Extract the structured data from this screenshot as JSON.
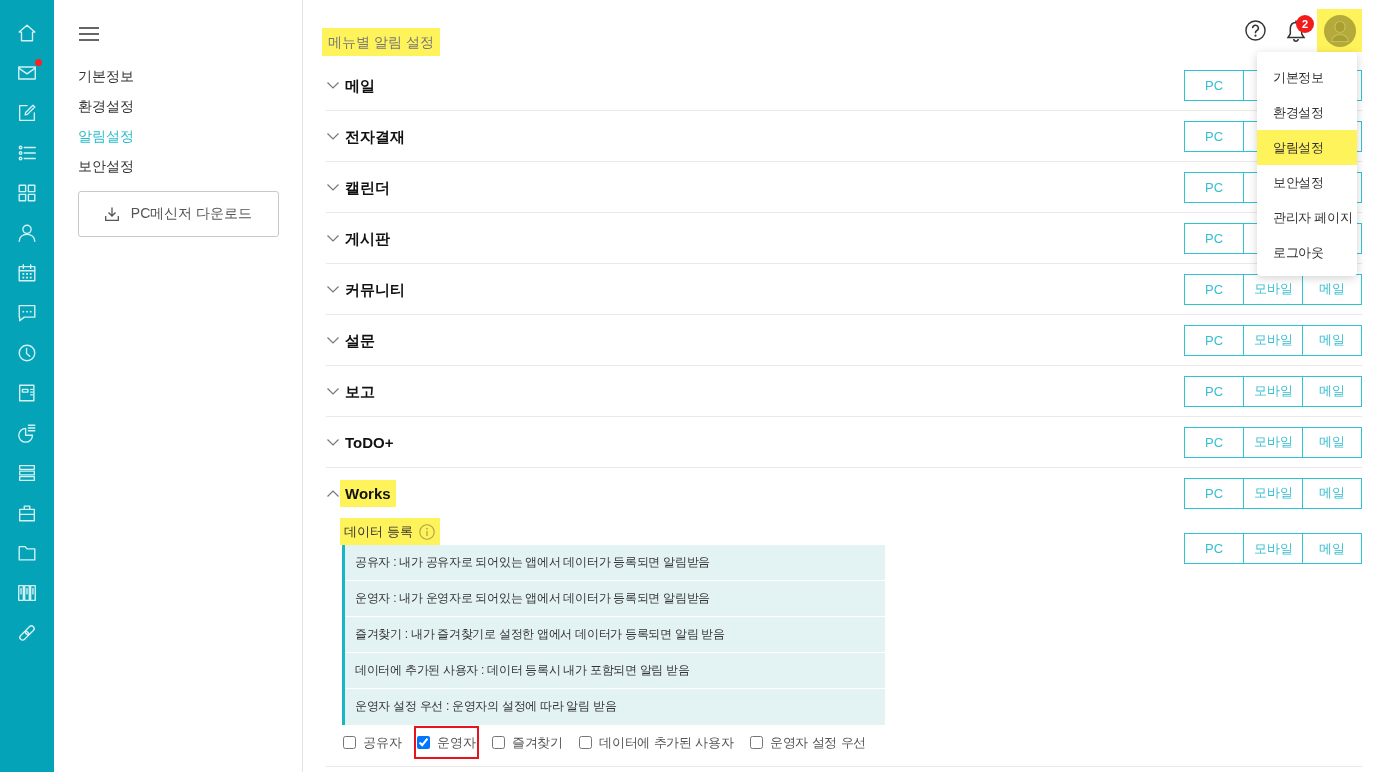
{
  "icon_rail": [
    {
      "notify": false
    },
    {
      "notify": true
    },
    {
      "notify": false
    },
    {
      "notify": false
    },
    {
      "notify": false
    },
    {
      "notify": false
    },
    {
      "notify": false
    },
    {
      "notify": false
    },
    {
      "notify": false
    },
    {
      "notify": false
    },
    {
      "notify": false
    },
    {
      "notify": false
    },
    {
      "notify": false
    },
    {
      "notify": false
    },
    {
      "notify": false
    },
    {
      "notify": false
    }
  ],
  "settings_menu": {
    "items": [
      {
        "label": "기본정보",
        "selected": false
      },
      {
        "label": "환경설정",
        "selected": false
      },
      {
        "label": "알림설정",
        "selected": true
      },
      {
        "label": "보안설정",
        "selected": false
      }
    ],
    "download_button": "PC메신저 다운로드"
  },
  "header": {
    "title": {
      "text": "메뉴별 알림 설정",
      "highlighted": true
    },
    "notification_count": "2",
    "avatar": {
      "highlighted": true
    }
  },
  "user_menu": {
    "items": [
      {
        "label": "기본정보",
        "highlighted": false
      },
      {
        "label": "환경설정",
        "highlighted": false
      },
      {
        "label": "알림설정",
        "highlighted": true
      },
      {
        "label": "보안설정",
        "highlighted": false
      },
      {
        "label": "관리자 페이지",
        "highlighted": false
      },
      {
        "label": "로그아웃",
        "highlighted": false
      }
    ]
  },
  "sections": [
    {
      "title": "메일",
      "expanded": false,
      "highlighted": false,
      "channels": [
        "PC"
      ]
    },
    {
      "title": "전자결재",
      "expanded": false,
      "highlighted": false,
      "channels": [
        "PC"
      ]
    },
    {
      "title": "캘린더",
      "expanded": false,
      "highlighted": false,
      "channels": [
        "PC"
      ]
    },
    {
      "title": "게시판",
      "expanded": false,
      "highlighted": false,
      "channels": [
        "PC"
      ]
    },
    {
      "title": "커뮤니티",
      "expanded": false,
      "highlighted": false,
      "channels": [
        "PC",
        "모바일",
        "메일"
      ]
    },
    {
      "title": "설문",
      "expanded": false,
      "highlighted": false,
      "channels": [
        "PC",
        "모바일",
        "메일"
      ]
    },
    {
      "title": "보고",
      "expanded": false,
      "highlighted": false,
      "channels": [
        "PC",
        "모바일",
        "메일"
      ]
    },
    {
      "title": "ToDO+",
      "expanded": false,
      "highlighted": false,
      "channels": [
        "PC",
        "모바일",
        "메일"
      ]
    },
    {
      "title": "Works",
      "expanded": true,
      "highlighted": true,
      "channels": [
        "PC",
        "모바일",
        "메일"
      ],
      "subsections": [
        {
          "title": "데이터 등록",
          "highlighted": true,
          "channels": [
            "PC",
            "모바일",
            "메일"
          ],
          "descriptions": [
            "공유자 : 내가 공유자로 되어있는 앱에서 데이터가 등록되면 알림받음",
            "운영자 : 내가 운영자로 되어있는 앱에서 데이터가 등록되면 알림받음",
            "즐겨찾기 : 내가 즐겨찾기로 설정한 앱에서 데이터가 등록되면 알림 받음",
            "데이터에 추가된 사용자 : 데이터 등록시 내가 포함되면 알림 받음",
            "운영자 설정 우선 : 운영자의 설정에 따라 알림 받음"
          ],
          "options": [
            {
              "label": "공유자",
              "checked": false,
              "outlined": false
            },
            {
              "label": "운영자",
              "checked": true,
              "outlined": true
            },
            {
              "label": "즐겨찾기",
              "checked": false,
              "outlined": false
            },
            {
              "label": "데이터에 추가된 사용자",
              "checked": false,
              "outlined": false
            },
            {
              "label": "운영자 설정 우선",
              "checked": false,
              "outlined": false
            }
          ]
        }
      ]
    }
  ]
}
